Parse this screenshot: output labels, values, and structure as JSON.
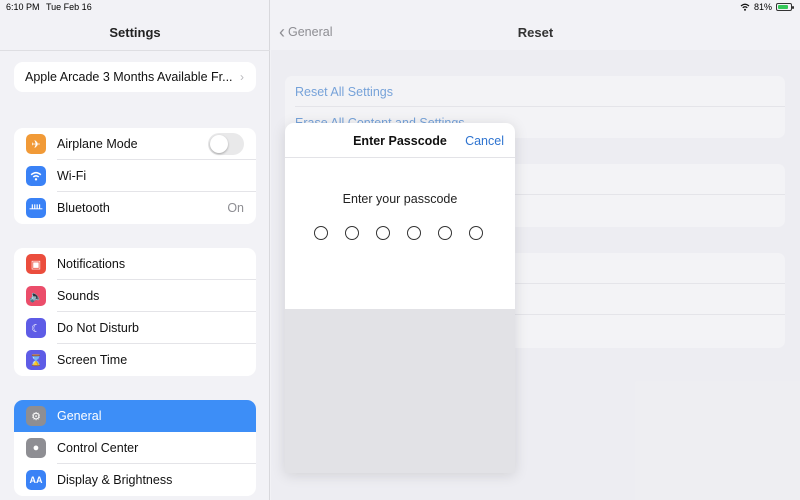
{
  "status": {
    "time": "6:10 PM",
    "date": "Tue Feb 16",
    "battery": "81%",
    "battery_level": 0.81
  },
  "sidebar": {
    "title": "Settings",
    "promo": "Apple Arcade 3 Months Available Fr...",
    "group1": [
      {
        "label": "Airplane Mode",
        "icon": "airplane-icon",
        "color": "#f19a37",
        "value": ""
      },
      {
        "label": "Wi-Fi",
        "icon": "wifi-icon",
        "color": "#3a82f6",
        "value": ""
      },
      {
        "label": "Bluetooth",
        "icon": "bluetooth-icon",
        "color": "#3a82f6",
        "value": "On"
      }
    ],
    "group2": [
      {
        "label": "Notifications",
        "icon": "notifications-icon",
        "color": "#eb4d3d"
      },
      {
        "label": "Sounds",
        "icon": "sounds-icon",
        "color": "#eb4d6a"
      },
      {
        "label": "Do Not Disturb",
        "icon": "moon-icon",
        "color": "#5e5ce6"
      },
      {
        "label": "Screen Time",
        "icon": "hourglass-icon",
        "color": "#5e5ce6"
      }
    ],
    "group3": [
      {
        "label": "General",
        "icon": "gear-icon",
        "color": "#8e8e93",
        "selected": true
      },
      {
        "label": "Control Center",
        "icon": "toggles-icon",
        "color": "#8e8e93"
      },
      {
        "label": "Display & Brightness",
        "icon": "aa-icon",
        "color": "#3a82f6",
        "glyph": "AA"
      }
    ]
  },
  "detail": {
    "back_label": "General",
    "title": "Reset",
    "items": [
      {
        "label": "Reset All Settings"
      },
      {
        "label": "Erase All Content and Settings"
      }
    ]
  },
  "modal": {
    "title": "Enter Passcode",
    "cancel": "Cancel",
    "prompt": "Enter your passcode",
    "digits": 6
  },
  "colors": {
    "accent": "#3d8ef7",
    "link": "#3b7fd0"
  }
}
